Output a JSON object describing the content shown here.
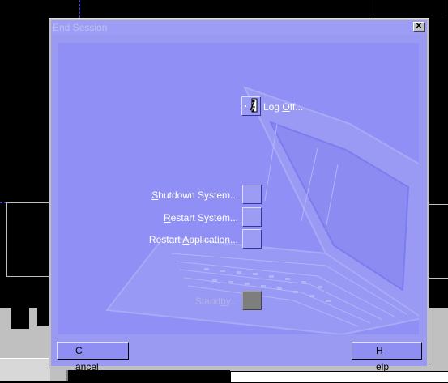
{
  "dialog": {
    "title": "End Session",
    "close_glyph": "✕"
  },
  "options": {
    "logoff": {
      "pre": "Lo",
      "key": "g",
      "post": " ",
      "key2": "O",
      "rest": "ff..."
    },
    "shutdown": {
      "key": "S",
      "rest": "hutdown System..."
    },
    "restart_system": {
      "key": "R",
      "rest": "estart System..."
    },
    "restart_app": {
      "pre": "Restart ",
      "key": "A",
      "rest": "pplication..."
    },
    "standby": {
      "pre": "Stand",
      "key": "b",
      "rest": "y..."
    }
  },
  "buttons": {
    "cancel": {
      "key": "C",
      "rest": "ancel"
    },
    "help": {
      "key": "H",
      "rest": "elp"
    }
  },
  "icons": {
    "logoff": "log-off-figure-icon",
    "close": "close-icon",
    "background_art": "laptop-illustration"
  },
  "colors": {
    "title_bar": "#9d9df6",
    "panel": "#8f8ff5",
    "frame": "#9a9af3",
    "disabled_button": "#7e7e7e"
  }
}
